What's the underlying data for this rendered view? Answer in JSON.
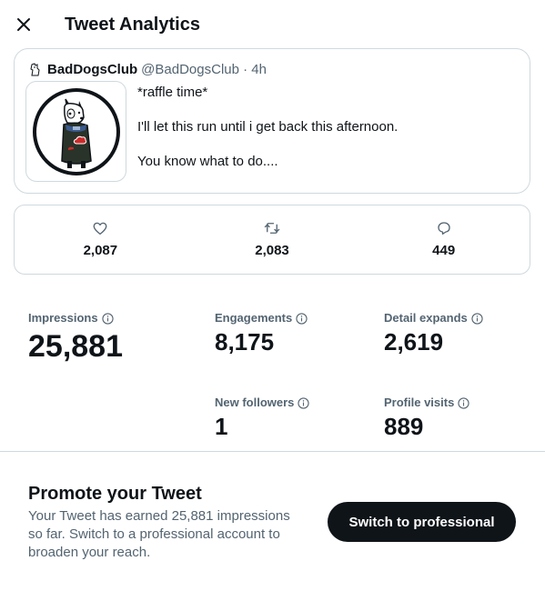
{
  "header": {
    "title": "Tweet Analytics",
    "close_icon": "close-icon"
  },
  "tweet": {
    "author_name": "BadDogsClub",
    "author_handle": "@BadDogsClub · 4h",
    "text_lines": [
      "*raffle time*",
      "I'll let this run until i get back this afternoon.",
      "You know what to do...."
    ]
  },
  "metrics": [
    {
      "icon": "heart-icon",
      "value": "2,087"
    },
    {
      "icon": "retweet-icon",
      "value": "2,083"
    },
    {
      "icon": "reply-icon",
      "value": "449"
    }
  ],
  "stats": {
    "impressions": {
      "label": "Impressions",
      "value": "25,881"
    },
    "engagements": {
      "label": "Engagements",
      "value": "8,175"
    },
    "detail_expands": {
      "label": "Detail expands",
      "value": "2,619"
    },
    "new_followers": {
      "label": "New followers",
      "value": "1"
    },
    "profile_visits": {
      "label": "Profile visits",
      "value": "889"
    }
  },
  "promote": {
    "title": "Promote your Tweet",
    "description": "Your Tweet has earned 25,881 impressions so far. Switch to a professional account to broaden your reach.",
    "button_label": "Switch to professional"
  },
  "colors": {
    "text_primary": "#0f1419",
    "text_secondary": "#536471",
    "border": "#cfd9de",
    "button_bg": "#0f1419"
  }
}
